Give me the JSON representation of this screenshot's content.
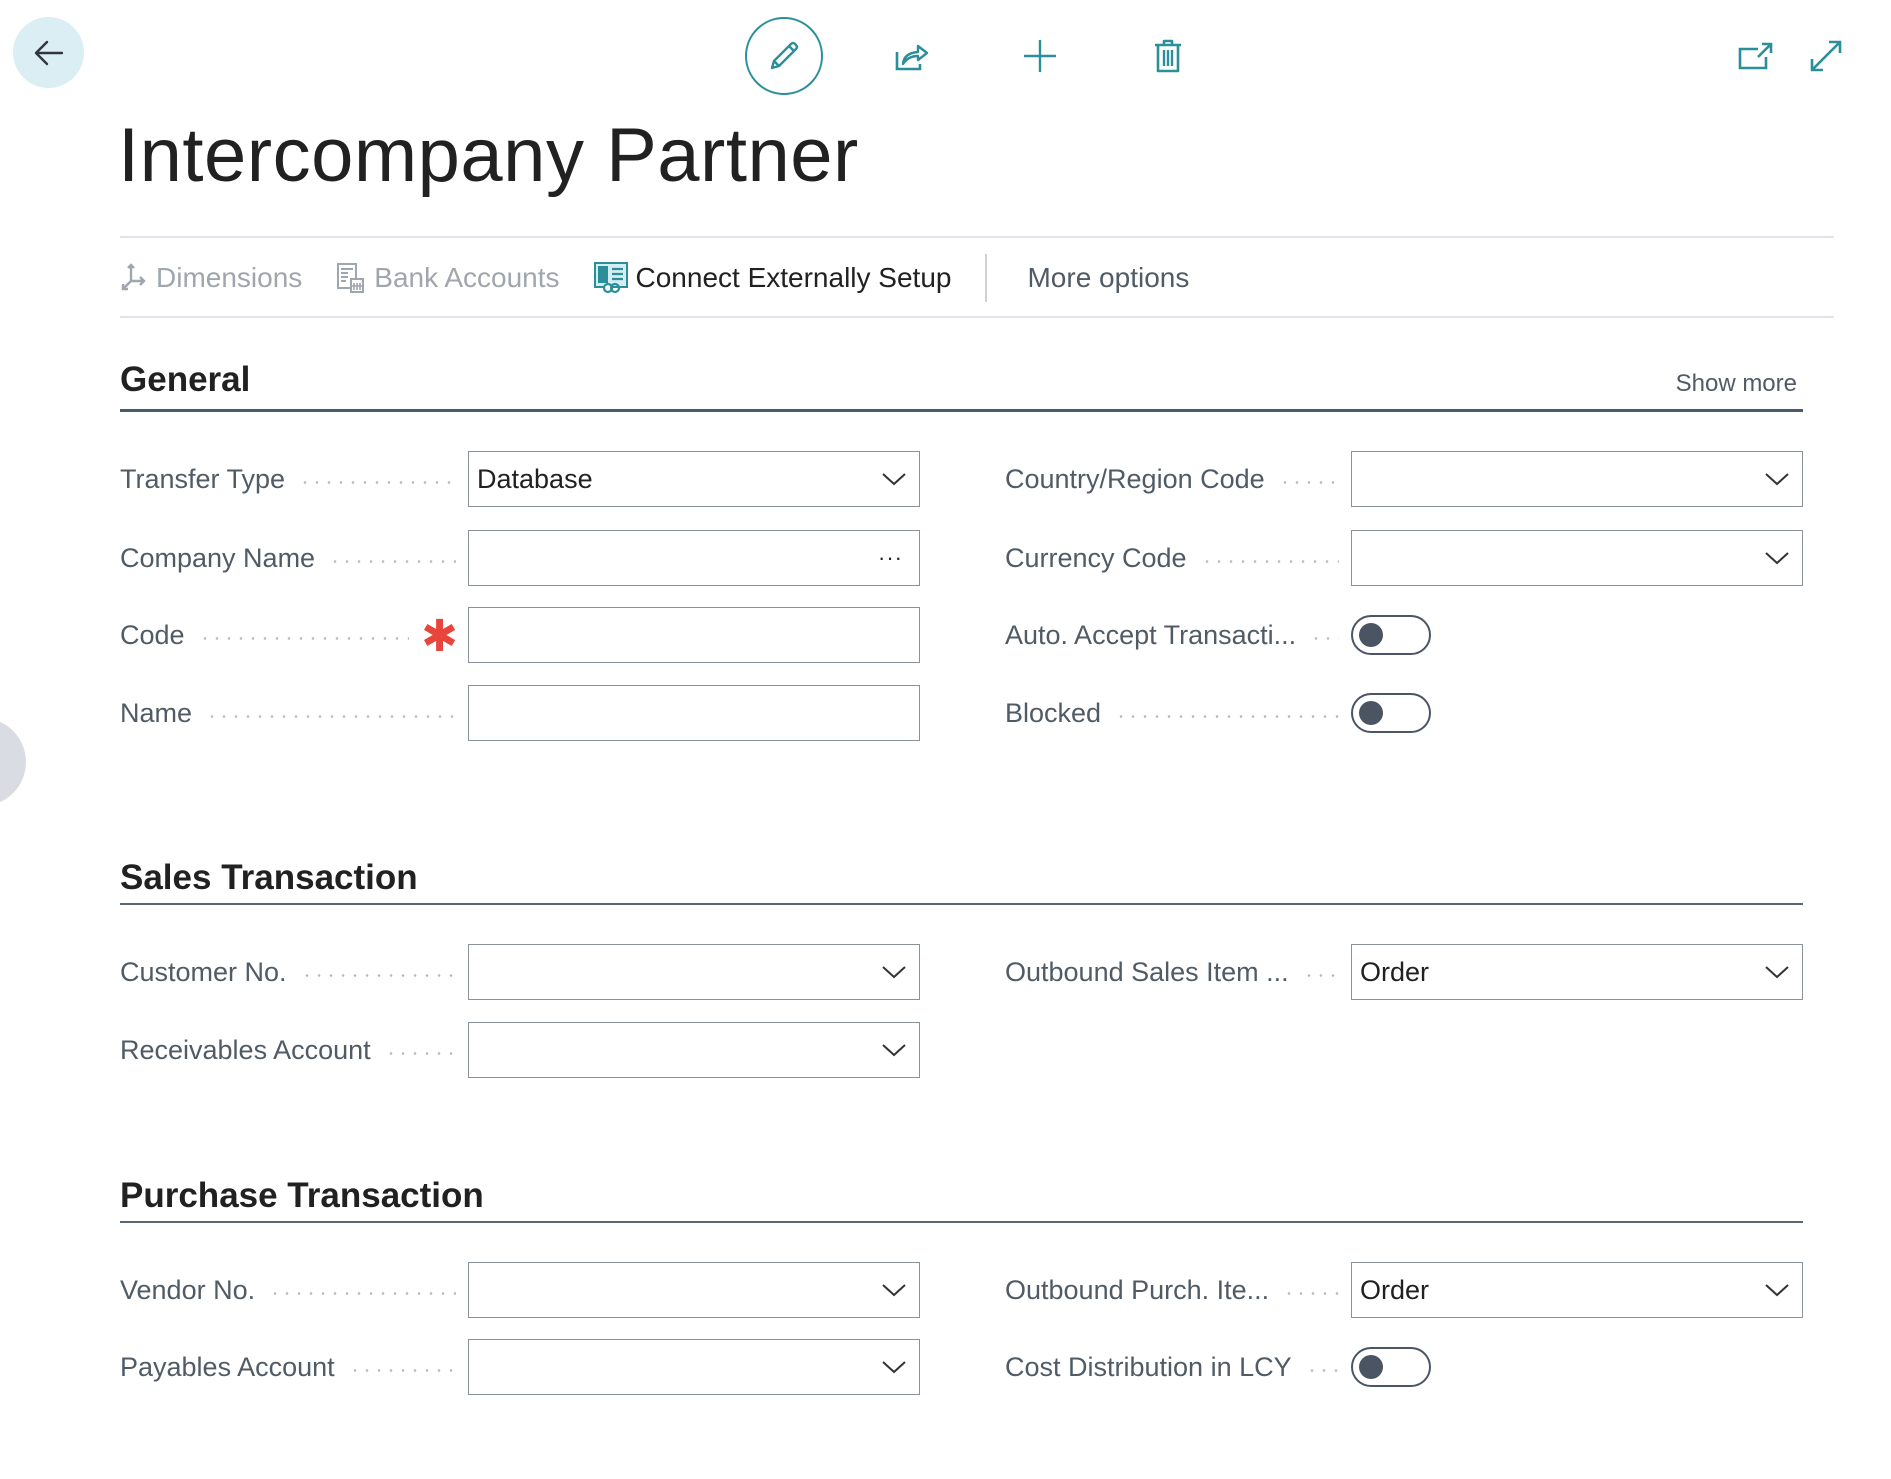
{
  "toolbar": {
    "back": {
      "icon": "back-arrow-icon",
      "label": "Back"
    },
    "edit": {
      "icon": "pencil-icon",
      "label": "Edit"
    },
    "share": {
      "icon": "share-icon",
      "label": "Share"
    },
    "new": {
      "icon": "plus-icon",
      "label": "New"
    },
    "delete": {
      "icon": "trash-icon",
      "label": "Delete"
    },
    "open_new_window": {
      "icon": "open-in-new-window-icon",
      "label": "Open in new window"
    },
    "expand": {
      "icon": "expand-icon",
      "label": "Expand"
    }
  },
  "page": {
    "title": "Intercompany Partner"
  },
  "actionbar": {
    "actions": [
      {
        "label": "Dimensions",
        "icon": "dimensions-icon",
        "enabled": false
      },
      {
        "label": "Bank Accounts",
        "icon": "bank-accounts-icon",
        "enabled": false
      },
      {
        "label": "Connect Externally Setup",
        "icon": "connect-externally-icon",
        "enabled": true
      }
    ],
    "more_options": "More options"
  },
  "sections": {
    "general": {
      "title": "General",
      "show_more": "Show more",
      "left": [
        {
          "label": "Transfer Type",
          "type": "dropdown",
          "value": "Database",
          "required": false
        },
        {
          "label": "Company Name",
          "type": "lookup",
          "value": "",
          "required": false,
          "lookup_glyph": "···"
        },
        {
          "label": "Code",
          "type": "text",
          "value": "",
          "required": true,
          "required_mark": "✱"
        },
        {
          "label": "Name",
          "type": "text",
          "value": "",
          "required": false
        }
      ],
      "right": [
        {
          "label": "Country/Region Code",
          "type": "dropdown",
          "value": ""
        },
        {
          "label": "Currency Code",
          "type": "dropdown",
          "value": ""
        },
        {
          "label": "Auto. Accept Transacti...",
          "type": "toggle",
          "value": false
        },
        {
          "label": "Blocked",
          "type": "toggle",
          "value": false
        }
      ]
    },
    "sales": {
      "title": "Sales Transaction",
      "left": [
        {
          "label": "Customer No.",
          "type": "dropdown",
          "value": ""
        },
        {
          "label": "Receivables Account",
          "type": "dropdown",
          "value": ""
        }
      ],
      "right": [
        {
          "label": "Outbound Sales Item ...",
          "type": "dropdown",
          "value": "Order"
        }
      ]
    },
    "purchase": {
      "title": "Purchase Transaction",
      "left": [
        {
          "label": "Vendor No.",
          "type": "dropdown",
          "value": ""
        },
        {
          "label": "Payables Account",
          "type": "dropdown",
          "value": ""
        }
      ],
      "right": [
        {
          "label": "Outbound Purch. Ite...",
          "type": "dropdown",
          "value": "Order"
        },
        {
          "label": "Cost Distribution in LCY",
          "type": "toggle",
          "value": false
        }
      ]
    }
  },
  "colors": {
    "accent": "#2b8f9a",
    "required": "#e8453c",
    "section_line": "#4b5b6b",
    "back_button_bg": "#dbeef4"
  }
}
